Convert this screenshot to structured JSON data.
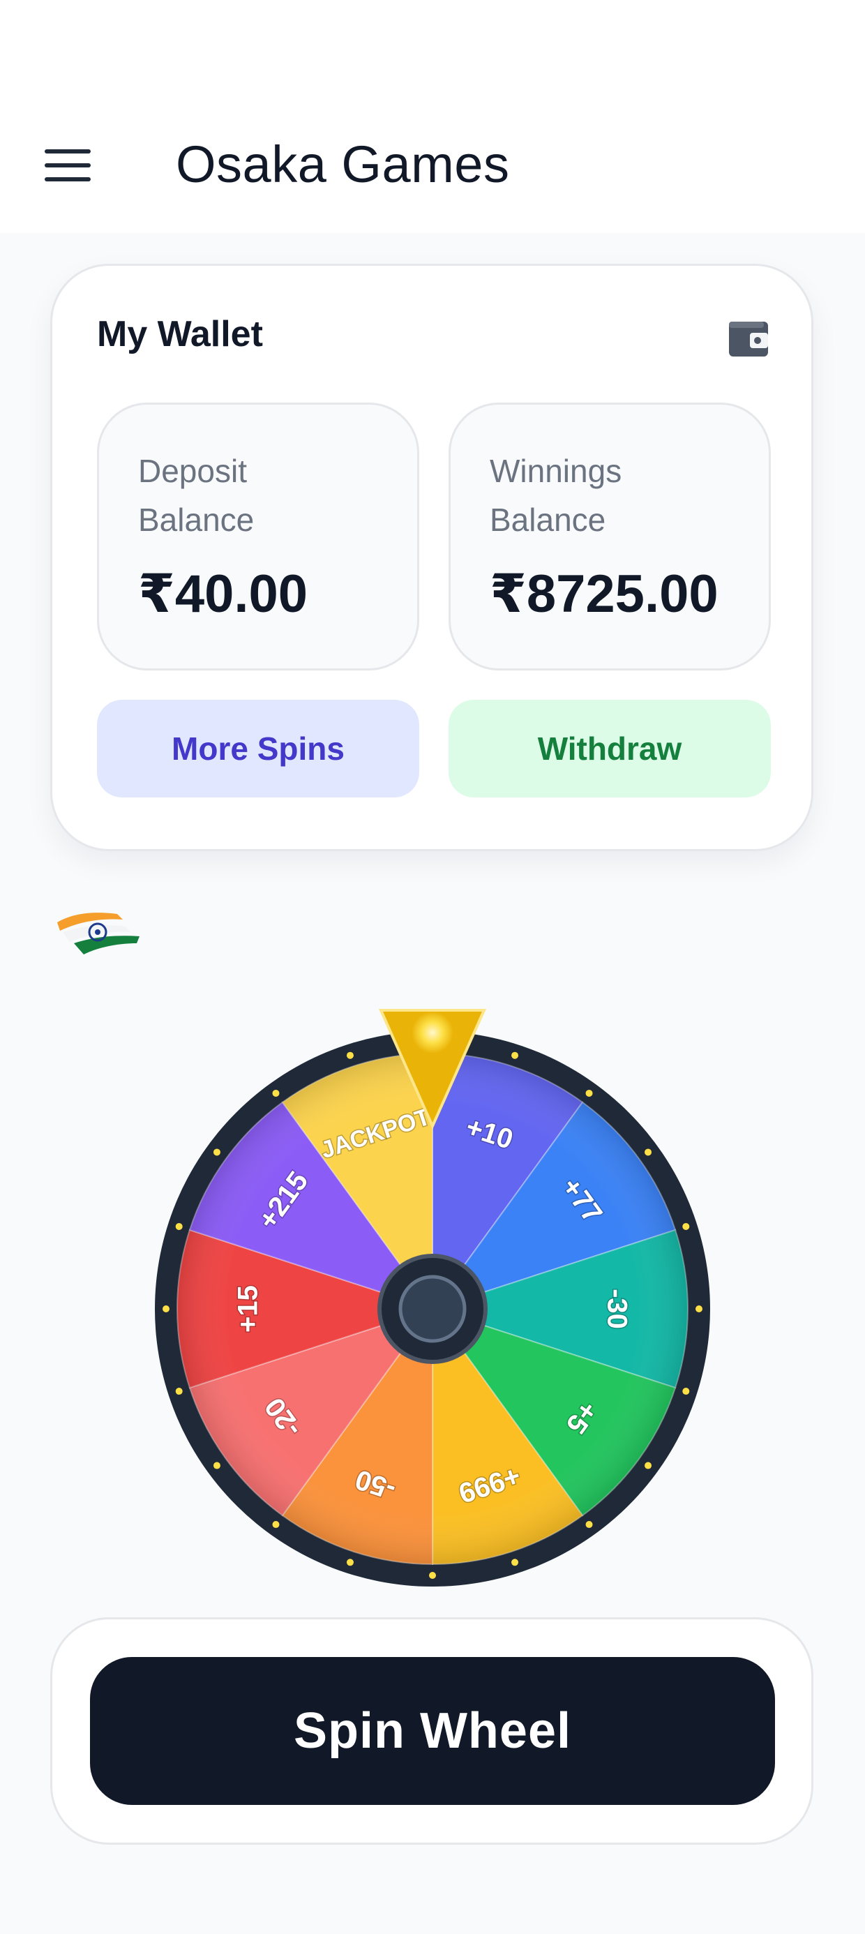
{
  "header": {
    "title": "Osaka Games",
    "menu_icon": "hamburger-menu-icon"
  },
  "wallet": {
    "title": "My Wallet",
    "icon": "wallet-icon",
    "deposit": {
      "label": "Deposit Balance",
      "value": "₹40.00"
    },
    "winnings": {
      "label": "Winnings Balance",
      "value": "₹8725.00"
    },
    "more_spins_label": "More Spins",
    "withdraw_label": "Withdraw"
  },
  "region": {
    "flag_icon": "india-flag-icon"
  },
  "wheel": {
    "segments": [
      {
        "label": "+10",
        "color": "#6366f1"
      },
      {
        "label": "+77",
        "color": "#3b82f6"
      },
      {
        "label": "-30",
        "color": "#14b8a6"
      },
      {
        "label": "+5",
        "color": "#22c55e"
      },
      {
        "label": "+999",
        "color": "#fbbf24"
      },
      {
        "label": "-50",
        "color": "#fb923c"
      },
      {
        "label": "-20",
        "color": "#f87171"
      },
      {
        "label": "+15",
        "color": "#ef4444"
      },
      {
        "label": "+215",
        "color": "#8b5cf6"
      },
      {
        "label": "JACKPOT",
        "color": "#fcd34d"
      }
    ],
    "rim_color": "#1f2937",
    "pointer_color": "#eab308"
  },
  "spin": {
    "label": "Spin Wheel"
  }
}
